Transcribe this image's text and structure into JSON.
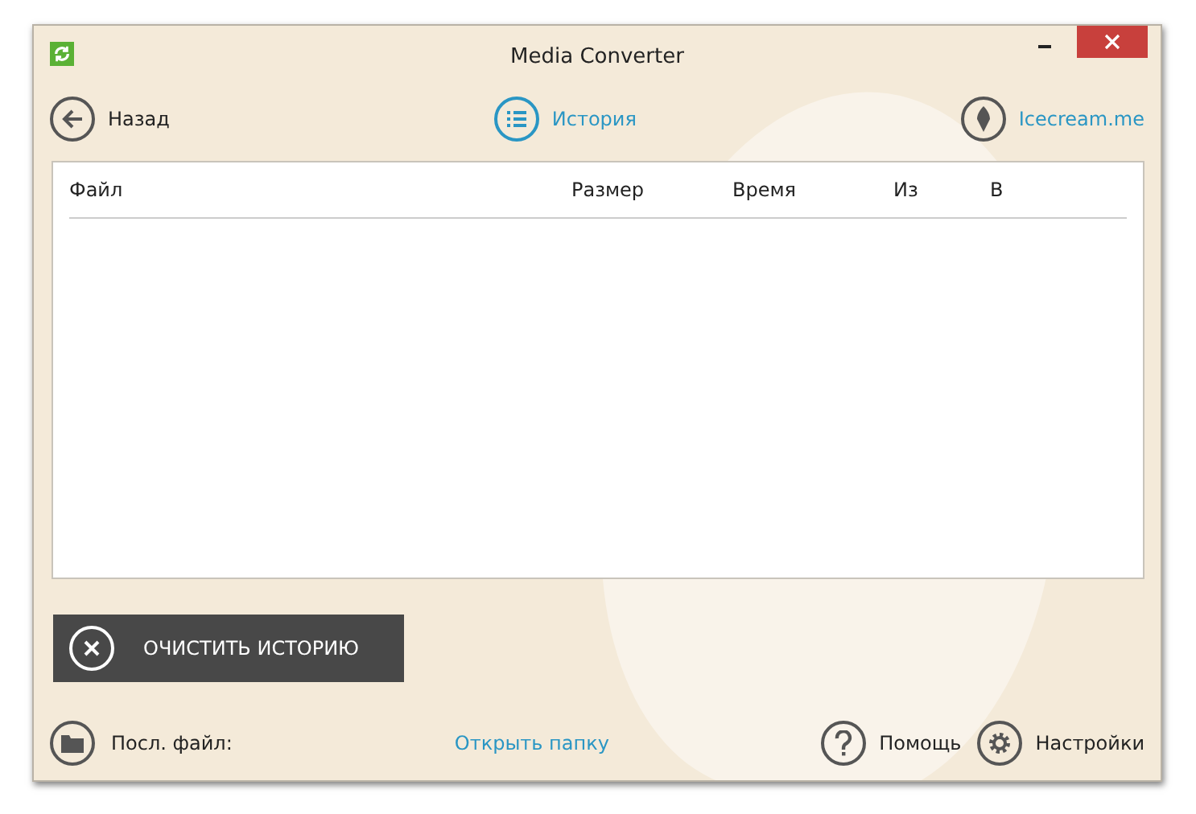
{
  "window": {
    "title": "Media Converter"
  },
  "nav": {
    "back": "Назад",
    "history": "История",
    "site": "Icecream.me"
  },
  "table": {
    "columns": [
      "Файл",
      "Размер",
      "Время",
      "Из",
      "В"
    ]
  },
  "clear_button": "ОЧИСТИТЬ ИСТОРИЮ",
  "footer": {
    "last_file": "Посл. файл:",
    "open_folder": "Открыть папку",
    "help": "Помощь",
    "settings": "Настройки"
  }
}
